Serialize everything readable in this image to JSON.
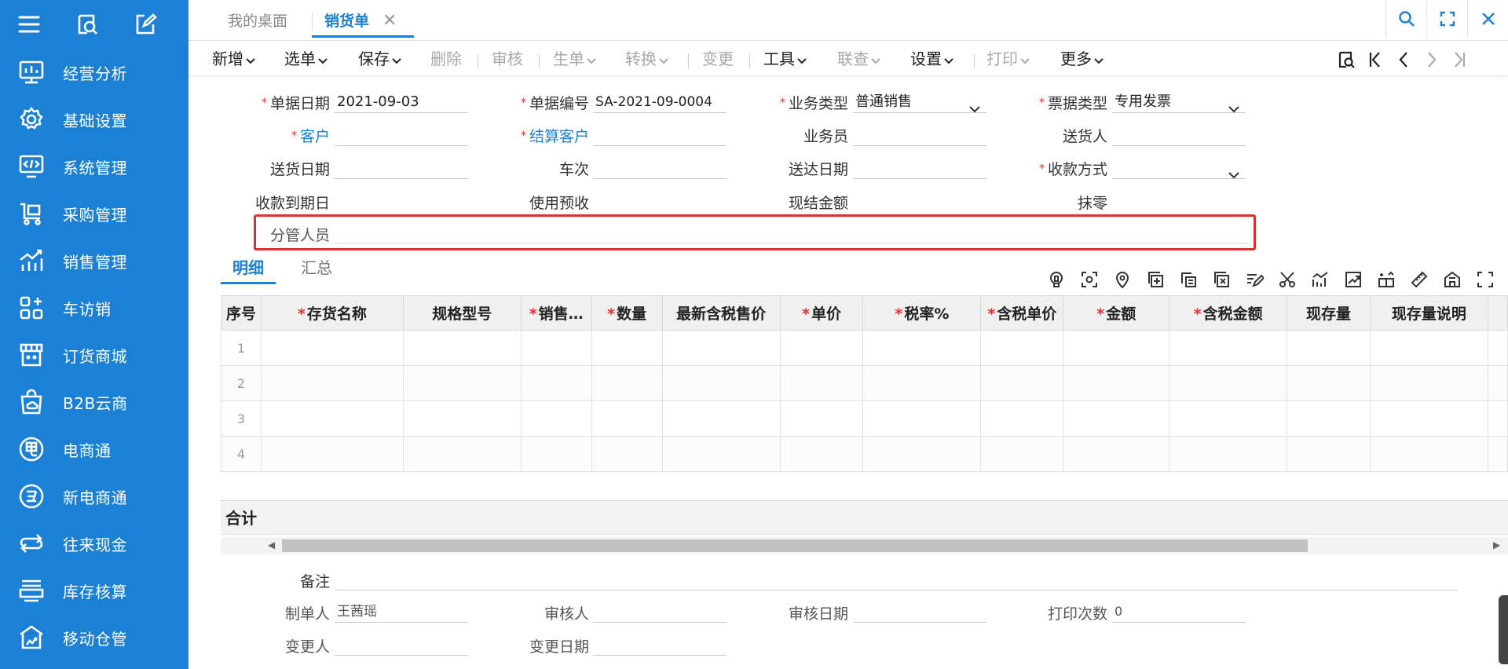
{
  "sidebar": {
    "top_icons": [
      "menu-icon",
      "magnify-report-icon",
      "edit-doc-icon"
    ],
    "items": [
      {
        "label": "经营分析",
        "icon": "analytics-icon"
      },
      {
        "label": "基础设置",
        "icon": "gear-icon"
      },
      {
        "label": "系统管理",
        "icon": "monitor-code-icon"
      },
      {
        "label": "采购管理",
        "icon": "cart-icon"
      },
      {
        "label": "销售管理",
        "icon": "sales-chart-icon"
      },
      {
        "label": "车访销",
        "icon": "grid-plus-icon"
      },
      {
        "label": "订货商城",
        "icon": "store-icon"
      },
      {
        "label": "B2B云商",
        "icon": "bag-cloud-icon"
      },
      {
        "label": "电商通",
        "icon": "electric-icon"
      },
      {
        "label": "新电商通",
        "icon": "new-ecommerce-icon"
      },
      {
        "label": "往来现金",
        "icon": "transfer-icon"
      },
      {
        "label": "库存核算",
        "icon": "printer-stack-icon"
      },
      {
        "label": "移动仓管",
        "icon": "warehouse-icon"
      }
    ]
  },
  "tabs": {
    "desk": "我的桌面",
    "active": "销货单",
    "close": "✕"
  },
  "toolbar": {
    "add": "新增",
    "select": "选单",
    "save": "保存",
    "delete": "删除",
    "audit": "审核",
    "generate": "生单",
    "convert": "转换",
    "change": "变更",
    "tools": "工具",
    "query": "联查",
    "settings": "设置",
    "print": "打印",
    "more": "更多"
  },
  "form": {
    "doc_date_label": "单据日期",
    "doc_date": "2021-09-03",
    "doc_no_label": "单据编号",
    "doc_no": "SA-2021-09-0004",
    "biz_type_label": "业务类型",
    "biz_type": "普通销售",
    "invoice_type_label": "票据类型",
    "invoice_type": "专用发票",
    "customer_label": "客户",
    "customer": "",
    "settle_customer_label": "结算客户",
    "settle_customer": "",
    "salesman_label": "业务员",
    "salesman": "",
    "deliverer_label": "送货人",
    "deliverer": "",
    "delivery_date_label": "送货日期",
    "delivery_date": "",
    "trip_label": "车次",
    "trip": "",
    "arrival_date_label": "送达日期",
    "arrival_date": "",
    "payment_method_label": "收款方式",
    "payment_method": "",
    "due_date_label": "收款到期日",
    "use_prepay_label": "使用预收",
    "cash_amount_label": "现结金额",
    "round_off_label": "抹零",
    "manager_label": "分管人员",
    "manager": ""
  },
  "detail_tabs": {
    "detail": "明细",
    "summary": "汇总"
  },
  "grid_icons": [
    "bulb-icon",
    "scan-icon",
    "location-icon",
    "copy-add-icon",
    "paste-icon",
    "export-icon",
    "edit-lines-icon",
    "scissors-icon",
    "line-chart-icon",
    "trend-icon",
    "split-icon",
    "ruler-icon",
    "home-icon",
    "expand-icon"
  ],
  "table": {
    "columns": [
      {
        "label": "序号",
        "req": false
      },
      {
        "label": "存货名称",
        "req": true
      },
      {
        "label": "规格型号",
        "req": false
      },
      {
        "label": "销售…",
        "req": true
      },
      {
        "label": "数量",
        "req": true
      },
      {
        "label": "最新含税售价",
        "req": false
      },
      {
        "label": "单价",
        "req": true
      },
      {
        "label": "税率%",
        "req": true
      },
      {
        "label": "含税单价",
        "req": true
      },
      {
        "label": "金额",
        "req": true
      },
      {
        "label": "含税金额",
        "req": true
      },
      {
        "label": "现存量",
        "req": false
      },
      {
        "label": "现存量说明",
        "req": false
      }
    ],
    "rows": [
      "1",
      "2",
      "3",
      "4"
    ]
  },
  "total_label": "合计",
  "footer": {
    "remark_label": "备注",
    "remark": "",
    "creator_label": "制单人",
    "creator": "王茜瑶",
    "auditor_label": "审核人",
    "auditor": "",
    "audit_date_label": "审核日期",
    "audit_date": "",
    "print_count_label": "打印次数",
    "print_count": "0",
    "changer_label": "变更人",
    "changer": "",
    "change_date_label": "变更日期",
    "change_date": ""
  },
  "colors": {
    "sidebar": "#1c80d4",
    "accent": "#1c80d4",
    "required": "#e0322f",
    "highlight_box": "#e0302a"
  }
}
